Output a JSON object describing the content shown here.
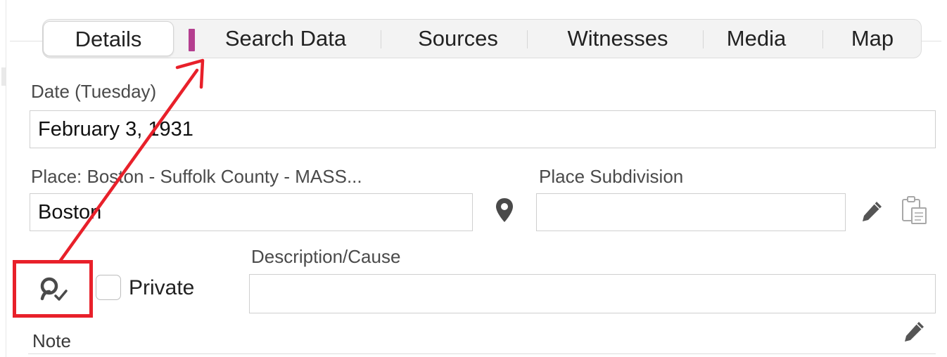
{
  "tabs": [
    {
      "label": "Details",
      "selected": true
    },
    {
      "label": "Search Data",
      "selected": false
    },
    {
      "label": "Sources",
      "selected": false
    },
    {
      "label": "Witnesses",
      "selected": false
    },
    {
      "label": "Media",
      "selected": false
    },
    {
      "label": "Map",
      "selected": false
    }
  ],
  "date": {
    "label": "Date (Tuesday)",
    "value": "February 3, 1931"
  },
  "place": {
    "label": "Place: Boston - Suffolk County - MASS...",
    "value": "Boston",
    "pin_icon": "map-pin-icon"
  },
  "place_subdivision": {
    "label": "Place Subdivision",
    "value": "",
    "edit_icon": "pencil-icon",
    "paste_icon": "clipboard-icon"
  },
  "search_toggle_icon": "person-search-check-icon",
  "private": {
    "label": "Private",
    "checked": false
  },
  "description": {
    "label": "Description/Cause",
    "value": ""
  },
  "note": {
    "label": "Note",
    "edit_icon": "pencil-icon"
  },
  "colors": {
    "annotation": "#e8202a",
    "tab_marker": "#b43e8f"
  }
}
